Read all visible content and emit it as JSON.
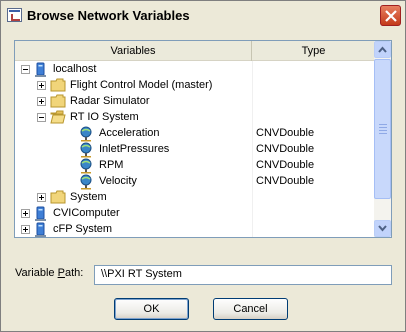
{
  "window": {
    "title": "Browse Network Variables"
  },
  "columns": {
    "variables": "Variables",
    "type": "Type"
  },
  "tree": {
    "localhost": {
      "label": "localhost"
    },
    "flight_control": {
      "label": "Flight Control Model (master)"
    },
    "radar_sim": {
      "label": "Radar Simulator"
    },
    "rtio": {
      "label": "RT IO System"
    },
    "acceleration": {
      "label": "Acceleration",
      "type": "CNVDouble"
    },
    "inlet": {
      "label": "InletPressures",
      "type": "CNVDouble"
    },
    "rpm": {
      "label": "RPM",
      "type": "CNVDouble"
    },
    "velocity": {
      "label": "Velocity",
      "type": "CNVDouble"
    },
    "system": {
      "label": "System"
    },
    "cvicomputer": {
      "label": "CVIComputer"
    },
    "cfp": {
      "label": "cFP System"
    }
  },
  "path": {
    "label_prefix": "Variable ",
    "label_accel": "P",
    "label_suffix": "ath:",
    "value": "\\\\PXI RT System"
  },
  "buttons": {
    "ok": "OK",
    "cancel": "Cancel"
  }
}
